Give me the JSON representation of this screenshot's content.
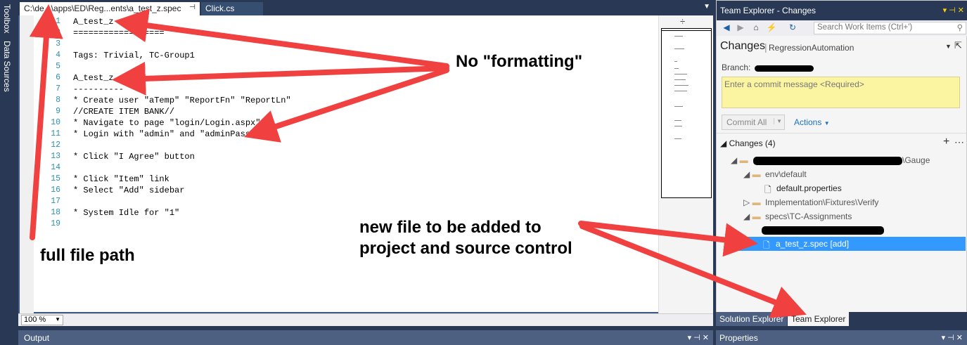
{
  "side_tabs": [
    "Toolbox",
    "Data Sources"
  ],
  "doc_tabs": [
    {
      "label": "C:\\de...\\apps\\ED\\Reg...ents\\a_test_z.spec",
      "pin": "⊣"
    },
    {
      "label": "Click.cs"
    }
  ],
  "editor": {
    "lines": [
      {
        "n": "1",
        "t": "A_test_z"
      },
      {
        "n": "2",
        "t": "=================="
      },
      {
        "n": "3",
        "t": ""
      },
      {
        "n": "4",
        "t": "Tags: Trivial, TC-Group1"
      },
      {
        "n": "5",
        "t": ""
      },
      {
        "n": "6",
        "t": "A_test_z"
      },
      {
        "n": "7",
        "t": "----------"
      },
      {
        "n": "8",
        "t": "* Create user \"aTemp\" \"ReportFn\" \"ReportLn\""
      },
      {
        "n": "9",
        "t": "//CREATE ITEM BANK//"
      },
      {
        "n": "10",
        "t": "* Navigate to page \"login/Login.aspx\""
      },
      {
        "n": "11",
        "t": "* Login with \"admin\" and \"adminPass\""
      },
      {
        "n": "12",
        "t": ""
      },
      {
        "n": "13",
        "t": "* Click \"I Agree\" button"
      },
      {
        "n": "14",
        "t": ""
      },
      {
        "n": "15",
        "t": "* Click \"Item\" link"
      },
      {
        "n": "16",
        "t": "* Select \"Add\" sidebar"
      },
      {
        "n": "17",
        "t": ""
      },
      {
        "n": "18",
        "t": "* System Idle for \"1\""
      },
      {
        "n": "19",
        "t": ""
      }
    ],
    "zoom": "100 %"
  },
  "output_panel": {
    "title": "Output"
  },
  "team_explorer": {
    "title": "Team Explorer - Changes",
    "search_placeholder": "Search Work Items (Ctrl+')",
    "heading": "Changes",
    "project": "RegressionAutomation",
    "branch_label": "Branch:",
    "commit_placeholder": "Enter a commit message <Required>",
    "commit_button": "Commit All",
    "actions_label": "Actions",
    "changes_header": "Changes (4)",
    "tree": {
      "root_suffix": "\\Gauge",
      "env": "env\\default",
      "default_props": "default.properties",
      "impl": "Implementation\\Fixtures\\Verify",
      "specs": "specs\\TC-Assignments",
      "new_file": "a_test_z.spec [add]"
    },
    "bottom_tabs": [
      "Solution Explorer",
      "Team Explorer"
    ]
  },
  "properties_panel": {
    "title": "Properties"
  },
  "annotations": {
    "no_formatting": "No \"formatting\"",
    "full_path": "full file path",
    "new_file_line1": "new file to be added to",
    "new_file_line2": "project and source control"
  },
  "colors": {
    "arrow": "#f04040",
    "accent": "#3399ff",
    "chrome": "#293955"
  }
}
